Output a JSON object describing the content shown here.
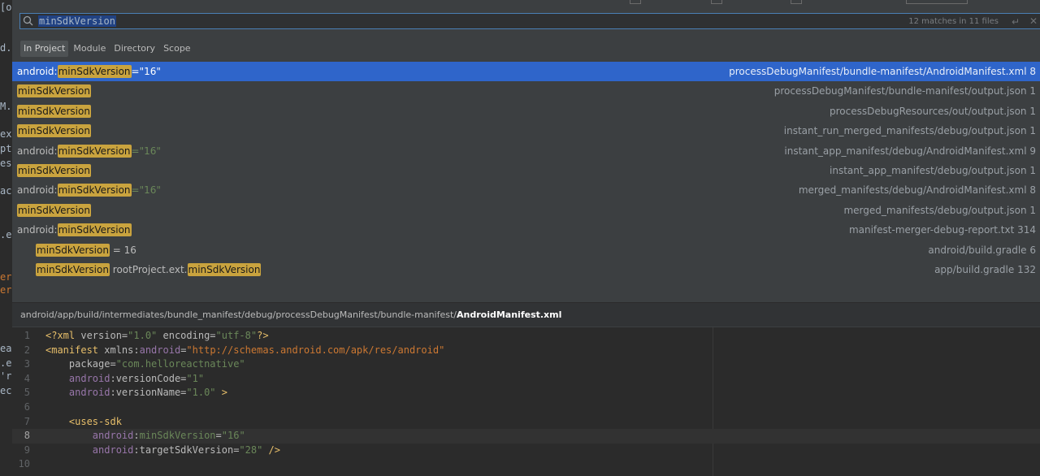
{
  "search": {
    "query": "minSdkVersion",
    "match_count": "12 matches in 11 files"
  },
  "scopes": [
    {
      "label": "In Project",
      "active": true
    },
    {
      "label": "Module",
      "active": false
    },
    {
      "label": "Directory",
      "active": false
    },
    {
      "label": "Scope",
      "active": false
    }
  ],
  "results": [
    {
      "prefix": "android:",
      "match": "minSdkVersion",
      "suffix": "=\"16\"",
      "suffix_type": "str",
      "match2": "",
      "location": "processDebugManifest/bundle-manifest/AndroidManifest.xml 8",
      "selected": true,
      "indent": false
    },
    {
      "prefix": "",
      "match": "minSdkVersion",
      "suffix": "",
      "suffix_type": "plain",
      "match2": "",
      "location": "processDebugManifest/bundle-manifest/output.json 1",
      "selected": false,
      "indent": false
    },
    {
      "prefix": "",
      "match": "minSdkVersion",
      "suffix": "",
      "suffix_type": "plain",
      "match2": "",
      "location": "processDebugResources/out/output.json 1",
      "selected": false,
      "indent": false
    },
    {
      "prefix": "",
      "match": "minSdkVersion",
      "suffix": "",
      "suffix_type": "plain",
      "match2": "",
      "location": "instant_run_merged_manifests/debug/output.json 1",
      "selected": false,
      "indent": false
    },
    {
      "prefix": "android:",
      "match": "minSdkVersion",
      "suffix": "=\"16\"",
      "suffix_type": "str",
      "match2": "",
      "location": "instant_app_manifest/debug/AndroidManifest.xml 9",
      "selected": false,
      "indent": false
    },
    {
      "prefix": "",
      "match": "minSdkVersion",
      "suffix": "",
      "suffix_type": "plain",
      "match2": "",
      "location": "instant_app_manifest/debug/output.json 1",
      "selected": false,
      "indent": false
    },
    {
      "prefix": "android:",
      "match": "minSdkVersion",
      "suffix": "=\"16\"",
      "suffix_type": "str",
      "match2": "",
      "location": "merged_manifests/debug/AndroidManifest.xml 8",
      "selected": false,
      "indent": false
    },
    {
      "prefix": "",
      "match": "minSdkVersion",
      "suffix": "",
      "suffix_type": "plain",
      "match2": "",
      "location": "merged_manifests/debug/output.json 1",
      "selected": false,
      "indent": false
    },
    {
      "prefix": "android:",
      "match": "minSdkVersion",
      "suffix": "",
      "suffix_type": "plain",
      "match2": "",
      "location": "manifest-merger-debug-report.txt 314",
      "selected": false,
      "indent": false
    },
    {
      "prefix": "",
      "match": "minSdkVersion",
      "suffix": " = 16",
      "suffix_type": "plain",
      "match2": "",
      "location": "android/build.gradle 6",
      "selected": false,
      "indent": true
    },
    {
      "prefix": "",
      "match": "minSdkVersion",
      "suffix": " rootProject.ext.",
      "suffix_type": "plain",
      "match2": "minSdkVersion",
      "location": "app/build.gradle 132",
      "selected": false,
      "indent": true
    }
  ],
  "preview": {
    "path_prefix": "android/app/build/intermediates/bundle_manifest/debug/processDebugManifest/bundle-manifest/",
    "file_name": "AndroidManifest.xml",
    "lines": [
      {
        "n": "1",
        "segs": [
          [
            "tag",
            "<?xml "
          ],
          [
            "attr",
            "version="
          ],
          [
            "val",
            "\"1.0\""
          ],
          [
            "attr",
            " encoding="
          ],
          [
            "val",
            "\"utf-8\""
          ],
          [
            "tag",
            "?>"
          ]
        ]
      },
      {
        "n": "2",
        "segs": [
          [
            "tag",
            "<manifest "
          ],
          [
            "attr",
            "xmlns:"
          ],
          [
            "ns",
            "android"
          ],
          [
            "attr",
            "="
          ],
          [
            "url",
            "\"http://schemas.android.com/apk/res/android\""
          ]
        ]
      },
      {
        "n": "3",
        "segs": [
          [
            "attr",
            "    package="
          ],
          [
            "val",
            "\"com.helloreactnative\""
          ]
        ]
      },
      {
        "n": "4",
        "segs": [
          [
            "ns",
            "    android"
          ],
          [
            "attr",
            ":versionCode="
          ],
          [
            "val",
            "\"1\""
          ]
        ]
      },
      {
        "n": "5",
        "segs": [
          [
            "ns",
            "    android"
          ],
          [
            "attr",
            ":versionName="
          ],
          [
            "val",
            "\"1.0\""
          ],
          [
            "tag",
            " >"
          ]
        ]
      },
      {
        "n": "6",
        "segs": []
      },
      {
        "n": "7",
        "segs": [
          [
            "tag",
            "    <uses-sdk"
          ]
        ]
      },
      {
        "n": "8",
        "segs": [
          [
            "ns",
            "        android"
          ],
          [
            "attr",
            ":"
          ],
          [
            "val",
            "minSdkVersion"
          ],
          [
            "attr",
            "="
          ],
          [
            "val",
            "\"16\""
          ]
        ],
        "current": true
      },
      {
        "n": "9",
        "segs": [
          [
            "ns",
            "        android"
          ],
          [
            "attr",
            ":targetSdkVersion="
          ],
          [
            "val",
            "\"28\""
          ],
          [
            "tag",
            " />"
          ]
        ]
      },
      {
        "n": "10",
        "segs": []
      }
    ]
  },
  "left_strip": [
    "[oo",
    "d.g",
    "M.",
    "ex",
    "pt",
    "es",
    "ac",
    ".e",
    "er",
    "er",
    "ea",
    ".e",
    "'r",
    "ec"
  ]
}
